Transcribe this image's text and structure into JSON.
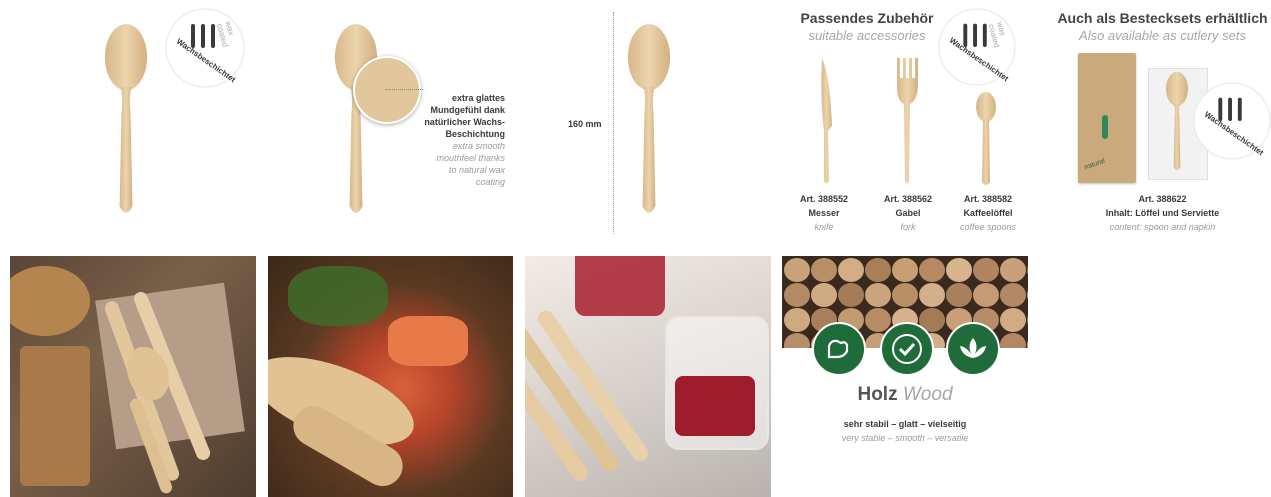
{
  "badge": {
    "text_dark": "Wachsbeschichtet",
    "text_light": "wax coated"
  },
  "panel2": {
    "callout_de": [
      "extra glattes",
      "Mundgefühl dank",
      "natürlicher Wachs-",
      "Beschichtung"
    ],
    "callout_en": [
      "extra smooth",
      "mouthfeel thanks",
      "to natural wax",
      "coating"
    ]
  },
  "panel3": {
    "dimension": "160 mm"
  },
  "accessories": {
    "title_de": "Passendes Zubehör",
    "title_en": "suitable accessories",
    "items": [
      {
        "art": "Art. 388552",
        "name": "Messer",
        "name_en": "knife"
      },
      {
        "art": "Art. 388562",
        "name": "Gabel",
        "name_en": "fork"
      },
      {
        "art": "Art. 388582",
        "name": "Kaffeelöffel",
        "name_en": "coffee spoons"
      }
    ]
  },
  "sets": {
    "title_de": "Auch als Bestecksets erhältlich",
    "title_en": "Also available as cutlery sets",
    "art": "Art. 388622",
    "content_de": "Inhalt: Löffel und Serviette",
    "content_en": "content: spoon and napkin",
    "pack_label": "natural"
  },
  "wood": {
    "title_de": "Holz",
    "title_en": "Wood",
    "desc_de": "sehr stabil – glatt – vielseitig",
    "desc_en": "very stable – smooth – versatile",
    "icons": [
      "strength-icon",
      "check-icon",
      "leaf-icon"
    ]
  },
  "colors": {
    "wood": "#e6c9a0",
    "wood_dark": "#c9a374",
    "green": "#1f6b3a",
    "badge_dark": "#3a3a3a",
    "badge_light": "#a8a8a8"
  }
}
